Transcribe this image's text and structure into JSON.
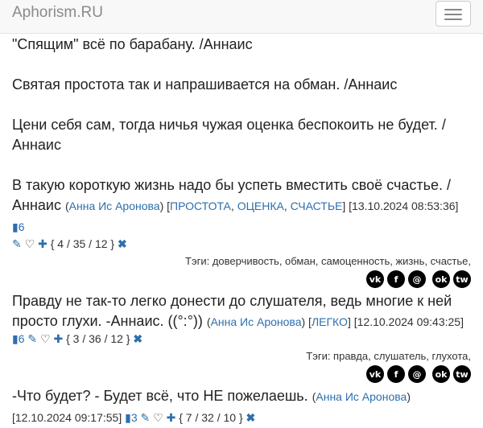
{
  "brand": "Aphorism.RU",
  "q1": "\"Спящим\" всё по барабану. /Аннаис",
  "q2": "Святая простота так и напрашивается на обман. /Аннаис",
  "q3": "Цени себя сам, тогда ничья чужая оценка беспокоить не будет. / Аннаис",
  "q4": {
    "text": "В такую короткую жизнь надо бы успеть вместить своё счастье. / Аннаис",
    "author": "Анна Ис Аронова",
    "tags": [
      "ПРОСТОТА",
      "ОЦЕНКА",
      "СЧАСТЬЕ"
    ],
    "date": "[13.10.2024 08:53:36]",
    "comments": "6",
    "stats": "{ 4 / 35 / 12 }",
    "taglist": "Тэги: доверчивость, обман, самоценность, жизнь, счастье,"
  },
  "q5": {
    "text": "Правду не так-то легко донести до слушателя, ведь многие к ней просто глухи. -Аннаис. ((°:°))",
    "author": "Анна Ис Аронова",
    "tags": [
      "ЛЕГКО"
    ],
    "date": "[12.10.2024 09:43:25]",
    "comments": "6",
    "stats": "{ 3 / 36 / 12 }",
    "taglist": "Тэги: правда, слушатель, глухота,"
  },
  "q6": {
    "text": "-Что будет? - Будет всё, что НЕ пожелаешь.",
    "author": "Анна Ис Аронова",
    "date": "[12.10.2024 09:17:55]",
    "comments": "3",
    "stats": "{ 7 / 32 / 10 }"
  },
  "share": [
    "vk",
    "f",
    "@",
    "ok",
    "tw"
  ]
}
